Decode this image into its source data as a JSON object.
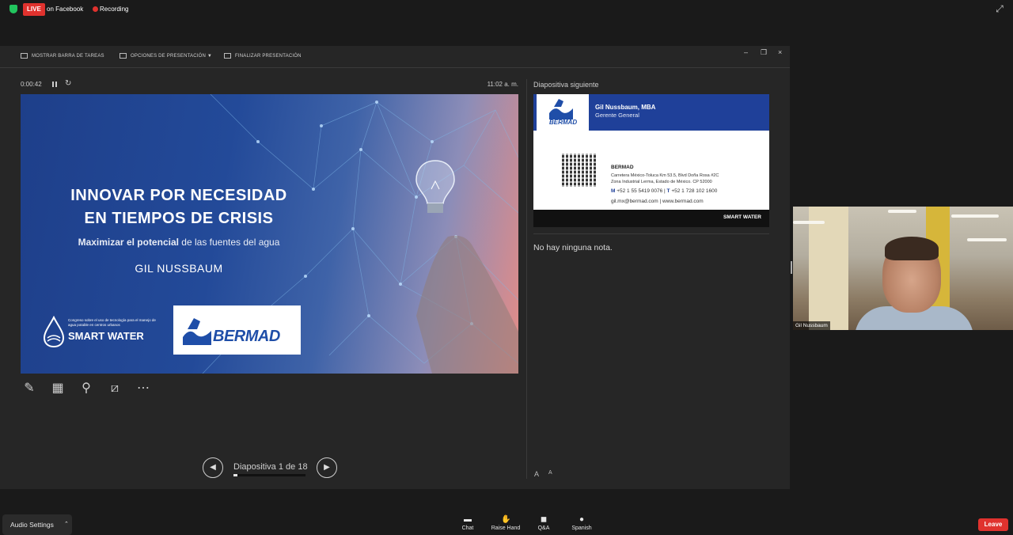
{
  "top": {
    "live_label": "LIVE",
    "stream_target": "on Facebook",
    "recording_label": "Recording"
  },
  "toolbar": {
    "taskbar_label": "MOSTRAR BARRA DE TAREAS",
    "options_label": "OPCIONES DE PRESENTACIÓN ▼",
    "end_label": "FINALIZAR PRESENTACIÓN"
  },
  "presenter": {
    "elapsed": "0:00:42",
    "clock": "11:02 a. m.",
    "slide_label": "Diapositiva 1 de 18",
    "progress": 0.06
  },
  "slide": {
    "title_line1": "INNOVAR POR NECESIDAD",
    "title_line2": "EN TIEMPOS DE CRISIS",
    "subtitle_bold": "Maximizar el potencial",
    "subtitle_rest": " de las fuentes del agua",
    "speaker": "GIL NUSSBAUM",
    "congress_text": "Congreso sobre el uso de tecnología para el manejo de agua potable en centros urbanos",
    "smartwater": "SMART WATER",
    "bermad": "BERMAD"
  },
  "next_slide": {
    "header": "Diapositiva siguiente",
    "logo": "BERMAD",
    "name": "Gil Nussbaum, MBA",
    "role": "Gerente General",
    "phones_m": "M",
    "phones_m_val": " +52 1 55 5419 0076  |  ",
    "phones_t": "T",
    "phones_t_val": " +52 1 728 102 1600",
    "contacts": "gil.mx@bermad.com | www.bermad.com",
    "company": "BERMAD",
    "address1": "Carretera México-Toluca Km 53.5, Blvd Doña Rosa #2C",
    "address2": "Zona Industrial Lerma, Estado de México. CP 52000",
    "footer_brand": "SMART WATER"
  },
  "notes": {
    "text": "No hay ninguna nota.",
    "font_smaller": "A",
    "font_larger": "A"
  },
  "video": {
    "participant": "Gil Nussbaum"
  },
  "bottom": {
    "audio_settings": "Audio Settings",
    "chat": "Chat",
    "raise_hand": "Raise Hand",
    "qa": "Q&A",
    "language": "Spanish",
    "leave": "Leave"
  }
}
